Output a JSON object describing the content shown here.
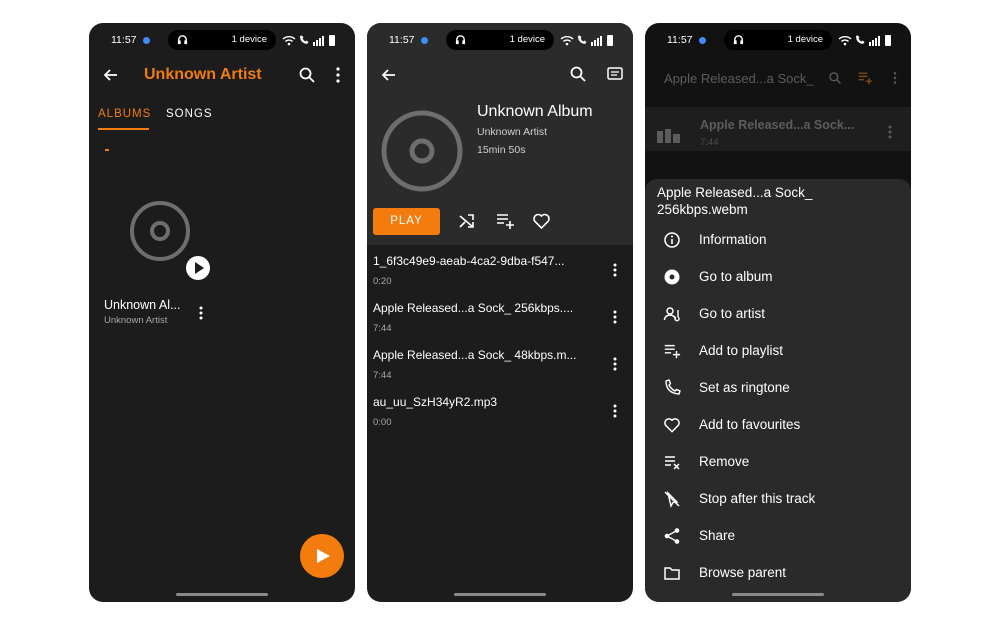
{
  "status": {
    "time": "11:57",
    "device": "1 device"
  },
  "screen1": {
    "title": "Unknown Artist",
    "tabs": [
      {
        "label": "ALBUMS",
        "active": true
      },
      {
        "label": "SONGS",
        "active": false
      }
    ],
    "album_title": "Unknown Al...",
    "album_artist": "Unknown Artist"
  },
  "screen2": {
    "album_title": "Unknown Album",
    "artist": "Unknown Artist",
    "duration": "15min 50s",
    "play_label": "PLAY",
    "tracks": [
      {
        "title": "1_6f3c49e9-aeab-4ca2-9dba-f547...",
        "duration": "0:20"
      },
      {
        "title": "Apple Released...a Sock_ 256kbps....",
        "duration": "7:44"
      },
      {
        "title": "Apple Released...a Sock_ 48kbps.m...",
        "duration": "7:44"
      },
      {
        "title": "au_uu_SzH34yR2.mp3",
        "duration": "0:00"
      }
    ]
  },
  "screen3": {
    "title": "Apple Released...a Sock_",
    "track_title": "Apple Released...a Sock...",
    "track_duration": "7:44",
    "sheet_title_line1": "Apple Released...a Sock_",
    "sheet_title_line2": "256kbps.webm",
    "menu": [
      {
        "label": "Information",
        "icon": "info-icon"
      },
      {
        "label": "Go to album",
        "icon": "album-icon"
      },
      {
        "label": "Go to artist",
        "icon": "artist-icon"
      },
      {
        "label": "Add to playlist",
        "icon": "playlist-add-icon"
      },
      {
        "label": "Set as ringtone",
        "icon": "phone-icon"
      },
      {
        "label": "Add to favourites",
        "icon": "heart-icon"
      },
      {
        "label": "Remove",
        "icon": "playlist-remove-icon"
      },
      {
        "label": "Stop after this track",
        "icon": "stop-after-icon"
      },
      {
        "label": "Share",
        "icon": "share-icon"
      },
      {
        "label": "Browse parent",
        "icon": "folder-icon"
      }
    ]
  },
  "colors": {
    "accent": "#f47c0e",
    "background": "#1c1c1c",
    "sheet": "#2a2a2a"
  }
}
